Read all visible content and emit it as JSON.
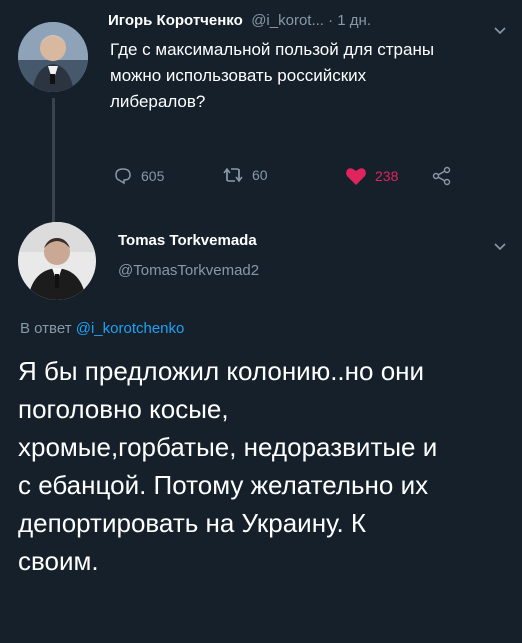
{
  "tweet1": {
    "author_name": "Игорь Коротченко",
    "handle_time": "@i_korot... · 1 дн.",
    "text": "Где с максимальной пользой для страны можно использовать российских либералов?",
    "replies": "605",
    "retweets": "60",
    "likes": "238",
    "colors": {
      "like": "#e0245e",
      "muted": "#8899a6",
      "background": "#15202b"
    }
  },
  "tweet2": {
    "author_name": "Tomas Torkvemada",
    "handle": "@TomasTorkvemad2",
    "reply_prefix": "В ответ",
    "reply_handle": "@i_korotchenko",
    "text": "Я бы предложил колонию..но они поголовно косые, хромые,горбатые, недоразвитые и с ебанцой. Потому желательно их депортировать на Украину. К своим.",
    "colors": {
      "link": "#1da1f2"
    }
  },
  "icons": [
    "reply-icon",
    "retweet-icon",
    "heart-icon",
    "share-icon",
    "chevron-down-icon"
  ]
}
